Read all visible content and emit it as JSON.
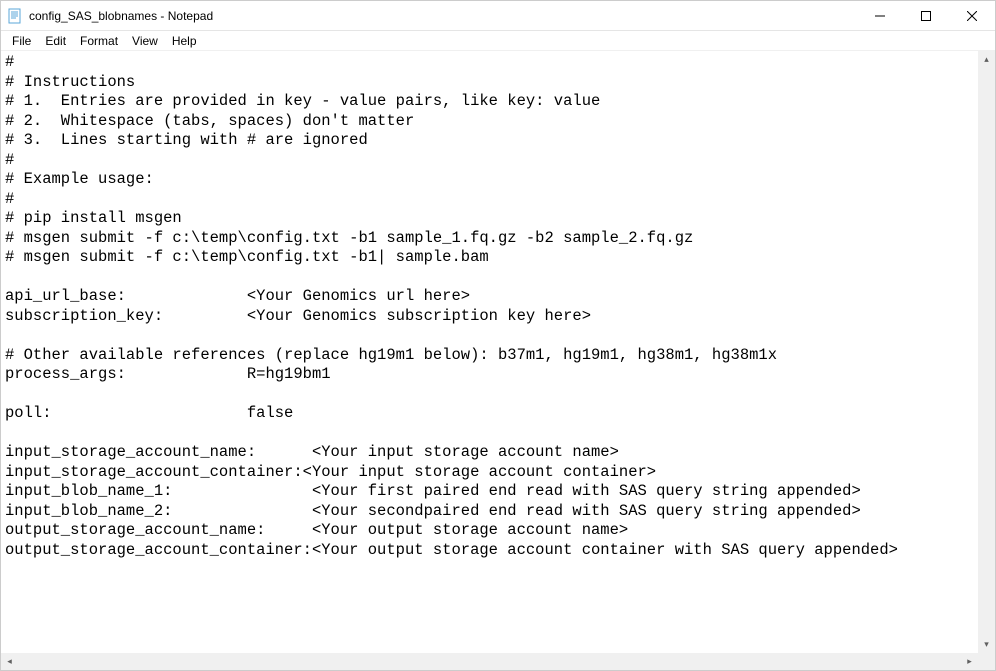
{
  "window": {
    "title": "config_SAS_blobnames - Notepad"
  },
  "menubar": {
    "items": [
      "File",
      "Edit",
      "Format",
      "View",
      "Help"
    ]
  },
  "document": {
    "lines": [
      "#",
      "# Instructions",
      "# 1.  Entries are provided in key - value pairs, like key: value",
      "# 2.  Whitespace (tabs, spaces) don't matter",
      "# 3.  Lines starting with # are ignored",
      "#",
      "# Example usage:",
      "#",
      "# pip install msgen",
      "# msgen submit -f c:\\temp\\config.txt -b1 sample_1.fq.gz -b2 sample_2.fq.gz",
      "# msgen submit -f c:\\temp\\config.txt -b1| sample.bam",
      "",
      "api_url_base:             <Your Genomics url here>",
      "subscription_key:         <Your Genomics subscription key here>",
      "",
      "# Other available references (replace hg19m1 below): b37m1, hg19m1, hg38m1, hg38m1x",
      "process_args:             R=hg19bm1",
      "",
      "poll:                     false",
      "",
      "input_storage_account_name:      <Your input storage account name>",
      "input_storage_account_container:<Your input storage account container>",
      "input_blob_name_1:               <Your first paired end read with SAS query string appended>",
      "input_blob_name_2:               <Your secondpaired end read with SAS query string appended>",
      "output_storage_account_name:     <Your output storage account name>",
      "output_storage_account_container:<Your output storage account container with SAS query appended>"
    ]
  }
}
